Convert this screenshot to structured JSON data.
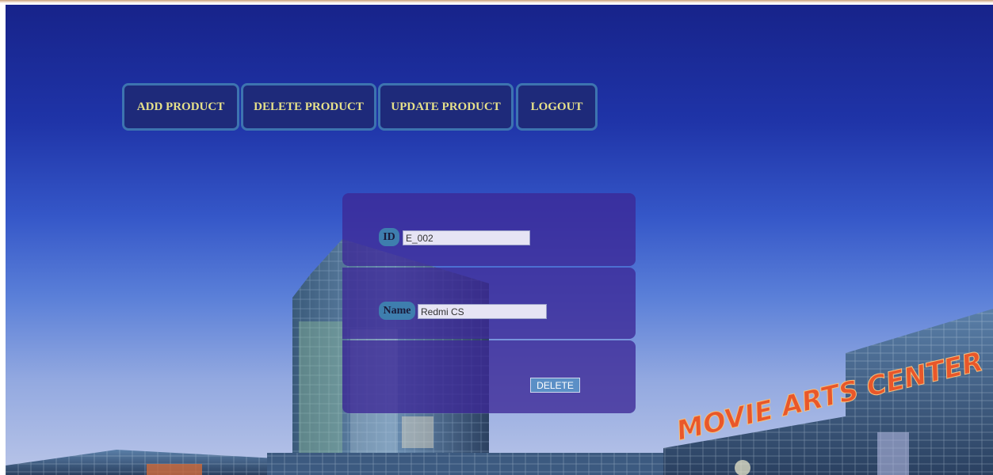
{
  "nav": {
    "add_product": "ADD PRODUCT",
    "delete_product": "DELETE PRODUCT",
    "update_product": "UPDATE PRODUCT",
    "logout": "LOGOUT"
  },
  "form": {
    "id_label": "ID",
    "id_value": "E_002",
    "name_label": "Name",
    "name_value": "Redmi CS",
    "delete_label": "DELETE"
  },
  "background": {
    "sign_text": "MOVIE ARTS CENTER"
  },
  "colors": {
    "nav_background": "#1e2a7a",
    "nav_border": "#3d74b0",
    "nav_text": "#e6e08a",
    "panel": "#3c2896",
    "label_background": "#3e7eae",
    "button": "#5b8fc6"
  }
}
